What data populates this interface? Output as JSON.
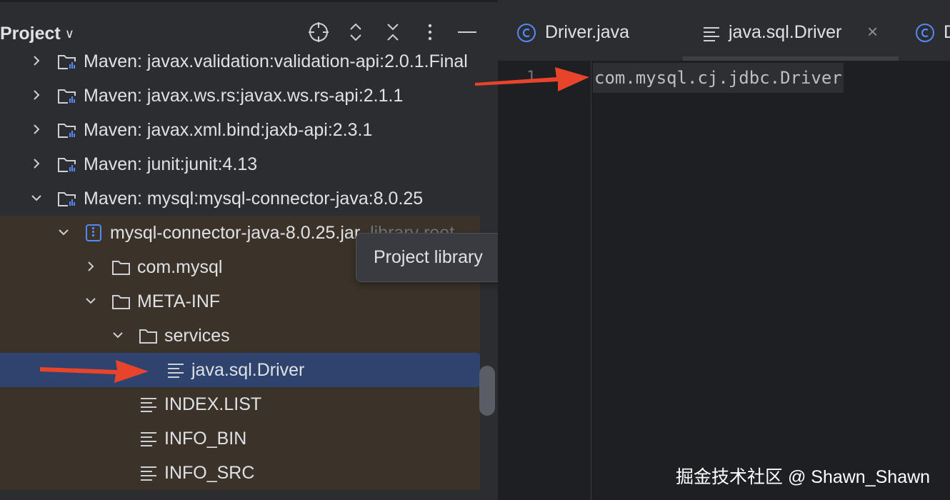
{
  "project_panel": {
    "title": "Project",
    "tree": [
      {
        "label": "Maven: javax.validation:validation-api:2.0.1.Final",
        "expanded": false
      },
      {
        "label": "Maven: javax.ws.rs:javax.ws.rs-api:2.1.1",
        "expanded": false
      },
      {
        "label": "Maven: javax.xml.bind:jaxb-api:2.3.1",
        "expanded": false
      },
      {
        "label": "Maven: junit:junit:4.13",
        "expanded": false
      },
      {
        "label": "Maven: mysql:mysql-connector-java:8.0.25",
        "expanded": true
      },
      {
        "label": "mysql-connector-java-8.0.25.jar",
        "hint": "library root",
        "expanded": true
      },
      {
        "label": "com.mysql",
        "expanded": false
      },
      {
        "label": "META-INF",
        "expanded": true
      },
      {
        "label": "services",
        "expanded": true
      },
      {
        "label": "java.sql.Driver",
        "selected": true
      },
      {
        "label": "INDEX.LIST"
      },
      {
        "label": "INFO_BIN"
      },
      {
        "label": "INFO_SRC"
      }
    ]
  },
  "tooltip": "Project library",
  "editor": {
    "tabs": [
      {
        "label": "Driver.java",
        "icon": "class-icon"
      },
      {
        "label": "java.sql.Driver",
        "icon": "text-file-icon",
        "active": true
      },
      {
        "label": "D",
        "icon": "class-icon"
      }
    ],
    "line_number": "1",
    "code": "com.mysql.cj.jdbc.Driver"
  },
  "watermark": "掘金技术社区 @ Shawn_Shawn",
  "colors": {
    "panel_bg": "#2b2d30",
    "editor_bg": "#1e1f22",
    "library_highlight": "#3b322a",
    "selection": "#2e436e",
    "annotation_arrow": "#e8442b",
    "class_icon": "#548af7"
  }
}
